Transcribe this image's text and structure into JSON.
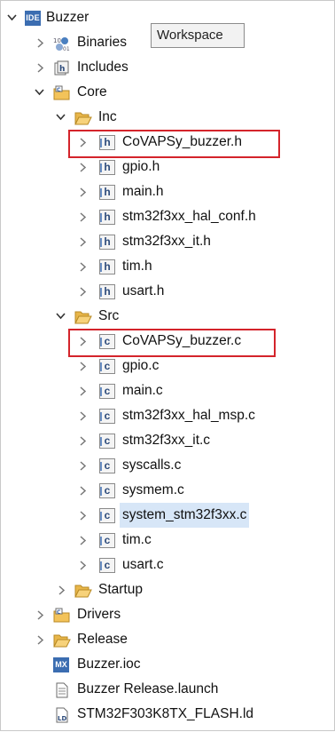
{
  "tooltip": "Workspace",
  "project": {
    "name": "Buzzer",
    "icon_text": "IDE",
    "icon": "ide-project-icon"
  },
  "nodes": {
    "binaries": "Binaries",
    "includes": "Includes",
    "core": "Core",
    "inc": "Inc",
    "inc_files": [
      "CoVAPSy_buzzer.h",
      "gpio.h",
      "main.h",
      "stm32f3xx_hal_conf.h",
      "stm32f3xx_it.h",
      "tim.h",
      "usart.h"
    ],
    "src": "Src",
    "src_files": [
      "CoVAPSy_buzzer.c",
      "gpio.c",
      "main.c",
      "stm32f3xx_hal_msp.c",
      "stm32f3xx_it.c",
      "syscalls.c",
      "sysmem.c",
      "system_stm32f3xx.c",
      "tim.c",
      "usart.c"
    ],
    "startup": "Startup",
    "drivers": "Drivers",
    "release": "Release",
    "ioc": "Buzzer.ioc",
    "ioc_icon_text": "MX",
    "launch": "Buzzer Release.launch",
    "ld": "STM32F303K8TX_FLASH.ld"
  },
  "header_icon_letter": "h",
  "source_icon_letter": "c",
  "selected_file": "system_stm32f3xx.c",
  "highlight_color": "#d4242b"
}
